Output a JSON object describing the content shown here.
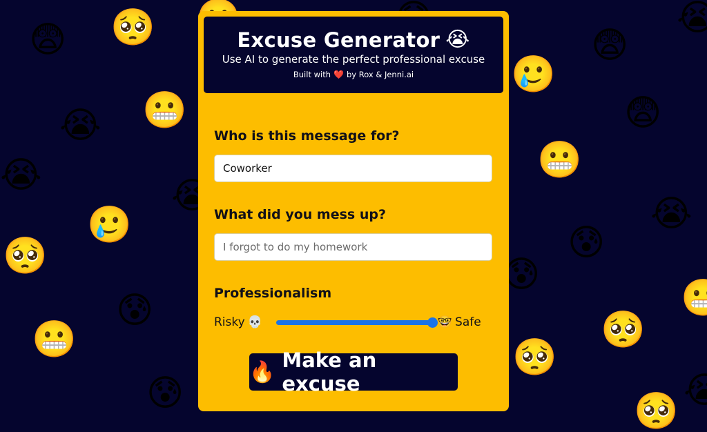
{
  "background": {
    "color": "#05052e",
    "emojis": [
      "😨",
      "🥺",
      "😬",
      "😭",
      "🥲",
      "🥺",
      "😰",
      "😬",
      "😰",
      "😭",
      "😭",
      "🥲",
      "😨",
      "😨",
      "😬",
      "😭",
      "😰",
      "😬",
      "🥺",
      "🥺",
      "😭",
      "😰",
      "😬",
      "🥺",
      "😰",
      "😭"
    ]
  },
  "header": {
    "title": "Excuse Generator",
    "title_emoji": "😭",
    "subtitle": "Use AI to generate the perfect professional excuse",
    "credit_prefix": "Built with",
    "credit_heart": "❤️",
    "credit_suffix": "by Rox & Jenni.ai"
  },
  "form": {
    "recipient_label": "Who is this message for?",
    "recipient_value": "Coworker",
    "mistake_label": "What did you mess up?",
    "mistake_value": "",
    "mistake_placeholder": "I forgot to do my homework",
    "professionalism_label": "Professionalism",
    "risky_label": "Risky",
    "risky_emoji": "💀",
    "safe_label": "Safe",
    "safe_emoji": "🤓",
    "professionalism_value": 1.0
  },
  "button": {
    "emoji": "🔥",
    "label": "Make an excuse"
  },
  "colors": {
    "accent": "#fdbd00",
    "dark": "#05052e",
    "slider": "#1a73e8"
  }
}
